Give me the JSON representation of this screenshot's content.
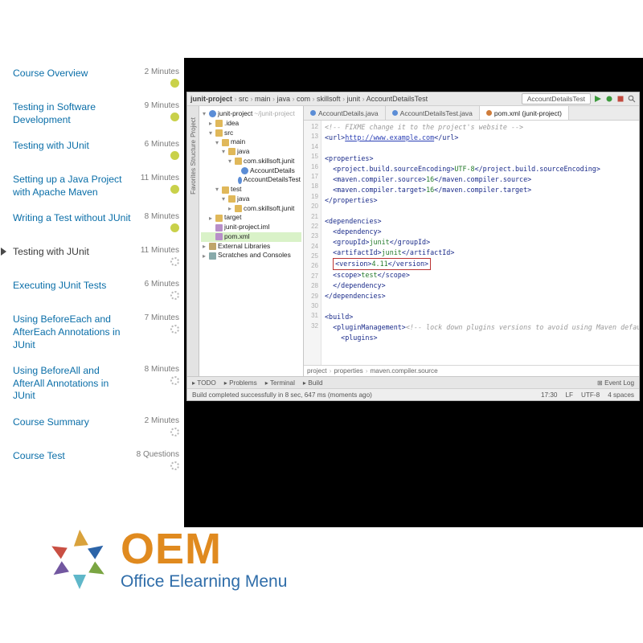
{
  "course_sidebar": {
    "items": [
      {
        "title": "Course Overview",
        "duration": "2 Minutes",
        "state": "done"
      },
      {
        "title": "Testing in Software Development",
        "duration": "9 Minutes",
        "state": "done"
      },
      {
        "title": "Testing with JUnit",
        "duration": "6 Minutes",
        "state": "done"
      },
      {
        "title": "Setting up a Java Project with Apache Maven",
        "duration": "11 Minutes",
        "state": "done"
      },
      {
        "title": "Writing a Test without JUnit",
        "duration": "8 Minutes",
        "state": "done"
      },
      {
        "title": "Testing with JUnit",
        "duration": "11 Minutes",
        "state": "pending",
        "active": true
      },
      {
        "title": "Executing JUnit Tests",
        "duration": "6 Minutes",
        "state": "pending"
      },
      {
        "title": "Using BeforeEach and AfterEach Annotations in JUnit",
        "duration": "7 Minutes",
        "state": "pending"
      },
      {
        "title": "Using BeforeAll and AfterAll Annotations in JUnit",
        "duration": "8 Minutes",
        "state": "pending"
      },
      {
        "title": "Course Summary",
        "duration": "2 Minutes",
        "state": "pending"
      },
      {
        "title": "Course Test",
        "duration": "8 Questions",
        "state": "pending"
      }
    ]
  },
  "ide": {
    "breadcrumb": [
      "junit-project",
      "src",
      "main",
      "java",
      "com",
      "skillsoft",
      "junit",
      "AccountDetailsTest"
    ],
    "run_config": "AccountDetailsTest",
    "gutter_labels": [
      "Project",
      "Structure",
      "Favorites"
    ],
    "project_tree": [
      {
        "lvl": 0,
        "icon": "mod",
        "twist": "▾",
        "label": "junit-project",
        "note": " ~/junit-project"
      },
      {
        "lvl": 1,
        "icon": "fold",
        "twist": "▸",
        "label": ".idea"
      },
      {
        "lvl": 1,
        "icon": "fold",
        "twist": "▾",
        "label": "src"
      },
      {
        "lvl": 2,
        "icon": "fold",
        "twist": "▾",
        "label": "main"
      },
      {
        "lvl": 3,
        "icon": "fold",
        "twist": "▾",
        "label": "java"
      },
      {
        "lvl": 4,
        "icon": "fold",
        "twist": "▾",
        "label": "com.skillsoft.junit"
      },
      {
        "lvl": 5,
        "icon": "java",
        "twist": "",
        "label": "AccountDetails"
      },
      {
        "lvl": 5,
        "icon": "java",
        "twist": "",
        "label": "AccountDetailsTest"
      },
      {
        "lvl": 2,
        "icon": "fold",
        "twist": "▾",
        "label": "test"
      },
      {
        "lvl": 3,
        "icon": "fold",
        "twist": "▾",
        "label": "java"
      },
      {
        "lvl": 4,
        "icon": "fold",
        "twist": "▸",
        "label": "com.skillsoft.junit"
      },
      {
        "lvl": 1,
        "icon": "fold",
        "twist": "▸",
        "label": "target"
      },
      {
        "lvl": 1,
        "icon": "xml",
        "twist": "",
        "label": "junit-project.iml"
      },
      {
        "lvl": 1,
        "icon": "xml",
        "twist": "",
        "label": "pom.xml",
        "sel": true
      },
      {
        "lvl": 0,
        "icon": "lib",
        "twist": "▸",
        "label": "External Libraries"
      },
      {
        "lvl": 0,
        "icon": "scr",
        "twist": "▸",
        "label": "Scratches and Consoles"
      }
    ],
    "editor_tabs": [
      {
        "label": "AccountDetails.java",
        "kind": "j"
      },
      {
        "label": "AccountDetailsTest.java",
        "kind": "j"
      },
      {
        "label": "pom.xml (junit-project)",
        "kind": "x",
        "active": true
      }
    ],
    "line_start": 12,
    "code_lines": [
      {
        "t": "comment",
        "text": "<!-- FIXME change it to the project's website -->"
      },
      {
        "t": "url",
        "text": "<url>http://www.example.com</url>"
      },
      {
        "t": "blank",
        "text": ""
      },
      {
        "t": "tag",
        "text": "<properties>"
      },
      {
        "t": "kv",
        "k": "project.build.sourceEncoding",
        "v": "UTF-8"
      },
      {
        "t": "kv",
        "k": "maven.compiler.source",
        "v": "16"
      },
      {
        "t": "kv",
        "k": "maven.compiler.target",
        "v": "16"
      },
      {
        "t": "tagc",
        "text": "</properties>"
      },
      {
        "t": "blank",
        "text": ""
      },
      {
        "t": "tag",
        "text": "<dependencies>"
      },
      {
        "t": "tag",
        "text": "  <dependency>"
      },
      {
        "t": "kv",
        "k": "groupId",
        "v": "junit"
      },
      {
        "t": "kv",
        "k": "artifactId",
        "v": "junit"
      },
      {
        "t": "kvbox",
        "k": "version",
        "v": "4.11"
      },
      {
        "t": "kv",
        "k": "scope",
        "v": "test"
      },
      {
        "t": "tagc",
        "text": "  </dependency>"
      },
      {
        "t": "tagc",
        "text": "</dependencies>"
      },
      {
        "t": "blank",
        "text": ""
      },
      {
        "t": "tag",
        "text": "<build>"
      },
      {
        "t": "pmgmt",
        "text": "  <pluginManagement>",
        "comment": "<!-- lock down plugins versions to avoid using Maven defaults"
      },
      {
        "t": "tag",
        "text": "    <plugins>"
      }
    ],
    "crumb2": [
      "project",
      "properties",
      "maven.compiler.source"
    ],
    "bottom_tabs": [
      "TODO",
      "Problems",
      "Terminal",
      "Build"
    ],
    "event_log": "Event Log",
    "status_left": "Build completed successfully in 8 sec, 647 ms (moments ago)",
    "status_right": [
      "17:30",
      "LF",
      "UTF-8",
      "4 spaces"
    ]
  },
  "brand": {
    "name": "OEM",
    "sub": "Office Elearning Menu"
  }
}
